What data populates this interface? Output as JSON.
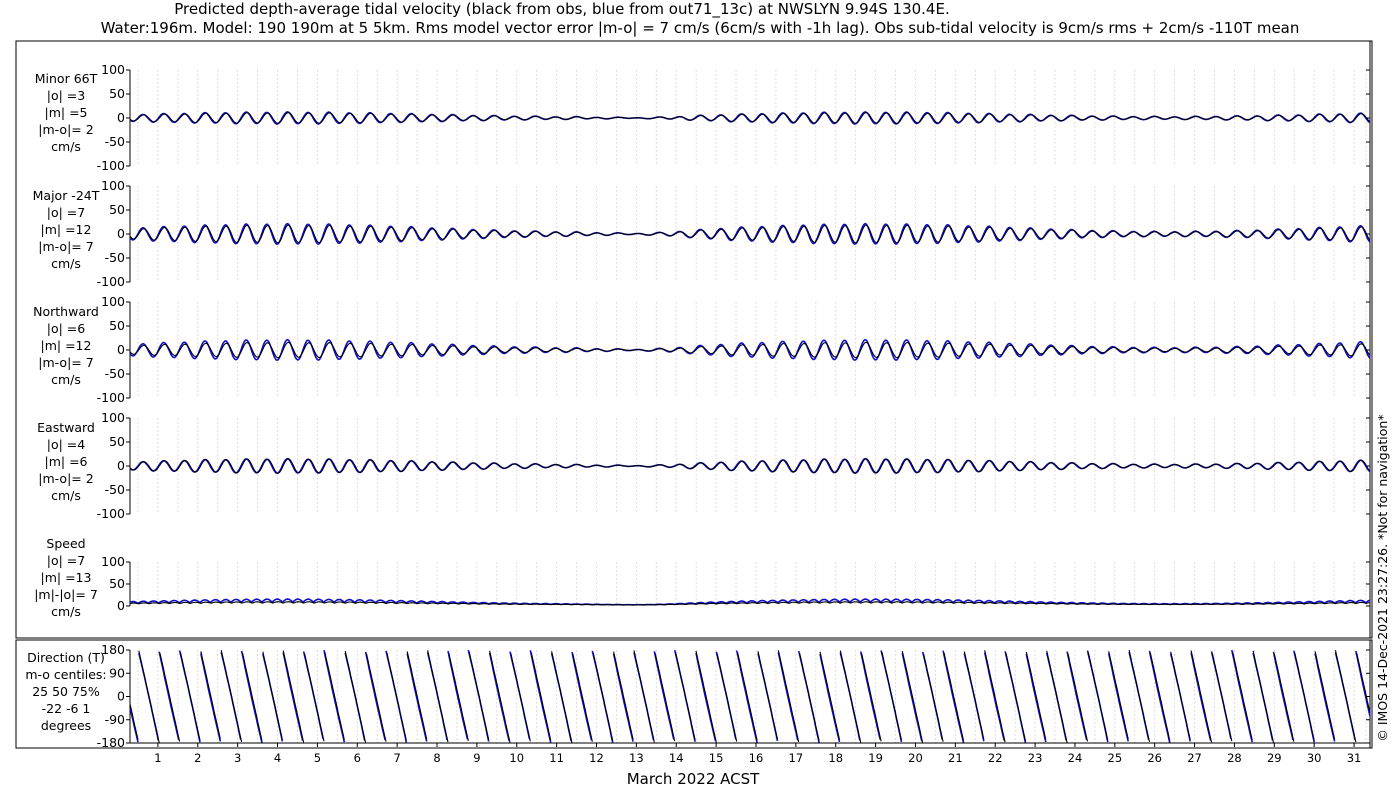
{
  "title": {
    "line1": "Predicted depth-average tidal velocity (black from obs, blue from out71_13c) at NWSLYN 9.94S 130.4E.",
    "line2": "Water:196m. Model: 190 190m at 5 5km. Rms model vector error |m-o| = 7 cm/s (6cm/s with -1h lag). Obs sub-tidal velocity is 9cm/s rms + 2cm/s -110T mean"
  },
  "xlabel": "March 2022 ACST",
  "footer": "© IMOS 14-Dec-2021 23:27:26. *Not for navigation*",
  "colors": {
    "obs": "#000000",
    "model": "#1010c8",
    "grid": "#c8c8c8"
  },
  "chart_data": [
    {
      "type": "line",
      "panel": "minor",
      "labels": [
        "Minor 66T",
        "|o| =3",
        "|m| =5",
        "|m-o|= 2",
        "cm/s"
      ],
      "ylim": [
        -100,
        100
      ],
      "yticks": [
        -100,
        -50,
        0,
        50,
        100
      ],
      "x": [
        1,
        31
      ],
      "xlim": [
        0.3,
        31.4
      ],
      "grid": true,
      "obs_amp": 3,
      "model_amp": 5,
      "units": "cm/s"
    },
    {
      "type": "line",
      "panel": "major",
      "labels": [
        "Major -24T",
        "|o| =7",
        "|m| =12",
        "|m-o|= 7",
        "cm/s"
      ],
      "ylim": [
        -100,
        100
      ],
      "yticks": [
        -100,
        -50,
        0,
        50,
        100
      ],
      "x": [
        1,
        31
      ],
      "xlim": [
        0.3,
        31.4
      ],
      "grid": true,
      "obs_amp": 7,
      "model_amp": 12,
      "units": "cm/s"
    },
    {
      "type": "line",
      "panel": "north",
      "labels": [
        "Northward",
        "|o| =6",
        "|m| =12",
        "|m-o|= 7",
        "cm/s"
      ],
      "ylim": [
        -100,
        100
      ],
      "yticks": [
        -100,
        -50,
        0,
        50,
        100
      ],
      "x": [
        1,
        31
      ],
      "xlim": [
        0.3,
        31.4
      ],
      "grid": true,
      "obs_amp": 6,
      "model_amp": 12,
      "units": "cm/s"
    },
    {
      "type": "line",
      "panel": "east",
      "labels": [
        "Eastward",
        "|o| =4",
        "|m| =6",
        "|m-o|= 2",
        "cm/s"
      ],
      "ylim": [
        -100,
        100
      ],
      "yticks": [
        -100,
        -50,
        0,
        50,
        100
      ],
      "x": [
        1,
        31
      ],
      "xlim": [
        0.3,
        31.4
      ],
      "grid": true,
      "obs_amp": 4,
      "model_amp": 6,
      "units": "cm/s"
    },
    {
      "type": "line",
      "panel": "speed",
      "labels": [
        "Speed",
        "|o| =7",
        "|m| =13",
        "|m|-|o|= 7",
        "cm/s"
      ],
      "ylim": [
        0,
        100
      ],
      "yticks": [
        0,
        50,
        100
      ],
      "x": [
        1,
        31
      ],
      "xlim": [
        0.3,
        31.4
      ],
      "grid": true,
      "obs_amp": 7,
      "model_amp": 13,
      "units": "cm/s"
    },
    {
      "type": "line",
      "panel": "direction",
      "labels": [
        "Direction (T)",
        "m-o centiles:",
        "25  50  75%",
        "-22  -6   1",
        "degrees"
      ],
      "ylim": [
        -180,
        180
      ],
      "yticks": [
        -180,
        -90,
        0,
        90,
        180
      ],
      "x": [
        1,
        31
      ],
      "xlim": [
        0.3,
        31.4
      ],
      "grid": true,
      "centiles": {
        "p25": -22,
        "p50": -6,
        "p75": 1
      },
      "units": "degrees"
    }
  ],
  "xticks": [
    1,
    2,
    3,
    4,
    5,
    6,
    7,
    8,
    9,
    10,
    11,
    12,
    13,
    14,
    15,
    16,
    17,
    18,
    19,
    20,
    21,
    22,
    23,
    24,
    25,
    26,
    27,
    28,
    29,
    30,
    31
  ]
}
